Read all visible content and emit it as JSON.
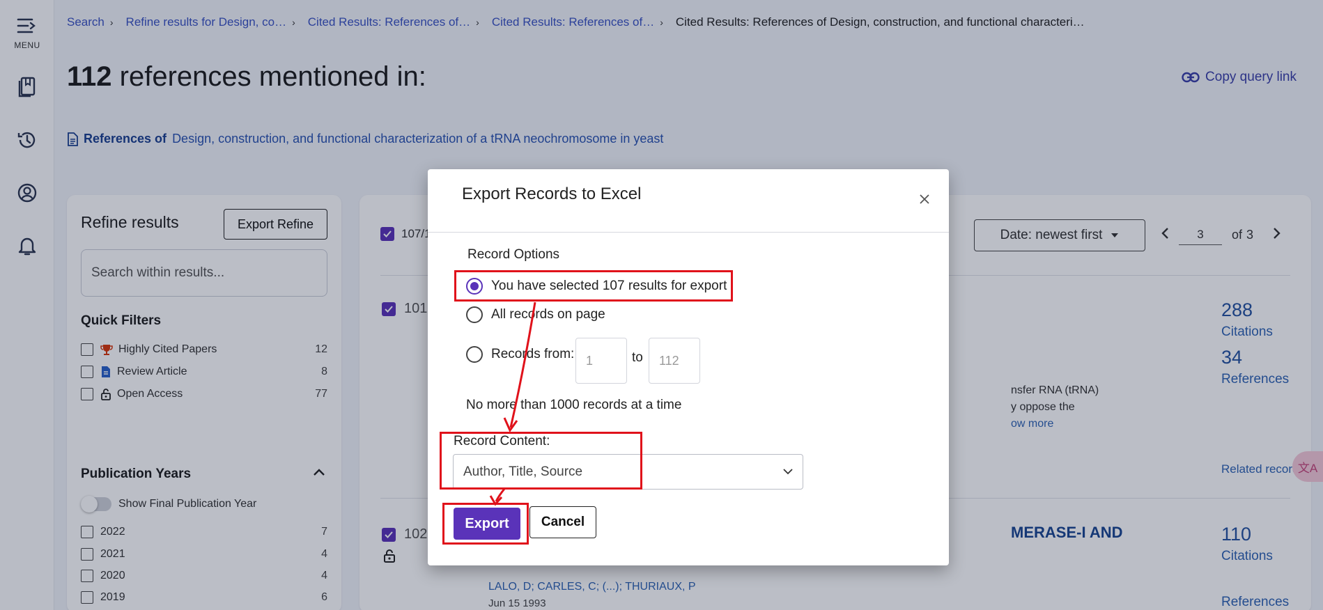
{
  "rail": {
    "menu_label": "MENU"
  },
  "breadcrumbs": [
    "Search",
    "Refine results for Design, co…",
    "Cited Results: References of…",
    "Cited Results: References of…",
    "Cited Results: References of Design, construction, and functional characteri…"
  ],
  "header": {
    "count": "112",
    "title_suffix": "references mentioned in:",
    "copy_link": "Copy query link",
    "ref_label": "References of",
    "ref_title": "Design, construction, and functional characterization of a tRNA neochromosome in yeast"
  },
  "refine": {
    "title": "Refine results",
    "export_refine": "Export Refine",
    "search_placeholder": "Search within results...",
    "quick_filters_title": "Quick Filters",
    "quick_filters": [
      {
        "label": "Highly Cited Papers",
        "count": "12",
        "icon": "trophy-icon"
      },
      {
        "label": "Review Article",
        "count": "8",
        "icon": "document-icon"
      },
      {
        "label": "Open Access",
        "count": "77",
        "icon": "lock-open-icon"
      }
    ],
    "pub_years_title": "Publication Years",
    "final_year_toggle": "Show Final Publication Year",
    "years": [
      {
        "label": "2022",
        "count": "7"
      },
      {
        "label": "2021",
        "count": "4"
      },
      {
        "label": "2020",
        "count": "4"
      },
      {
        "label": "2019",
        "count": "6"
      }
    ]
  },
  "results": {
    "selected": "107/1",
    "sort_label": "Date: newest first",
    "page_current": "3",
    "page_of": "of",
    "page_total": "3",
    "records": [
      {
        "num": "101",
        "citations_count": "288",
        "citations_label": "Citations",
        "references_count": "34",
        "references_label": "References",
        "abstract_lines": [
          "nsfer RNA (tRNA)",
          "y oppose the"
        ],
        "show_more": "ow more",
        "related": "Related records"
      },
      {
        "num": "102",
        "title_fragment": "MERASE-I AND",
        "authors": "LALO, D; CARLES, C; (...); THURIAUX, P",
        "date": "Jun 15 1993",
        "citations_count": "110",
        "citations_label": "Citations",
        "references_label": "References"
      }
    ],
    "translate_fab": "文A"
  },
  "modal": {
    "title": "Export Records to Excel",
    "record_options_label": "Record Options",
    "option_selected": "You have selected 107 results for export",
    "option_page": "All records on page",
    "option_range": "Records from:",
    "range_from_placeholder": "1",
    "range_to_label": "to",
    "range_to_placeholder": "112",
    "limit_note": "No more than 1000 records at a time",
    "record_content_label": "Record Content:",
    "record_content_value": "Author, Title, Source",
    "export_button": "Export",
    "cancel_button": "Cancel"
  },
  "colors": {
    "accent": "#5a33b9",
    "link": "#2f63b3",
    "annotation": "#e0121b"
  }
}
